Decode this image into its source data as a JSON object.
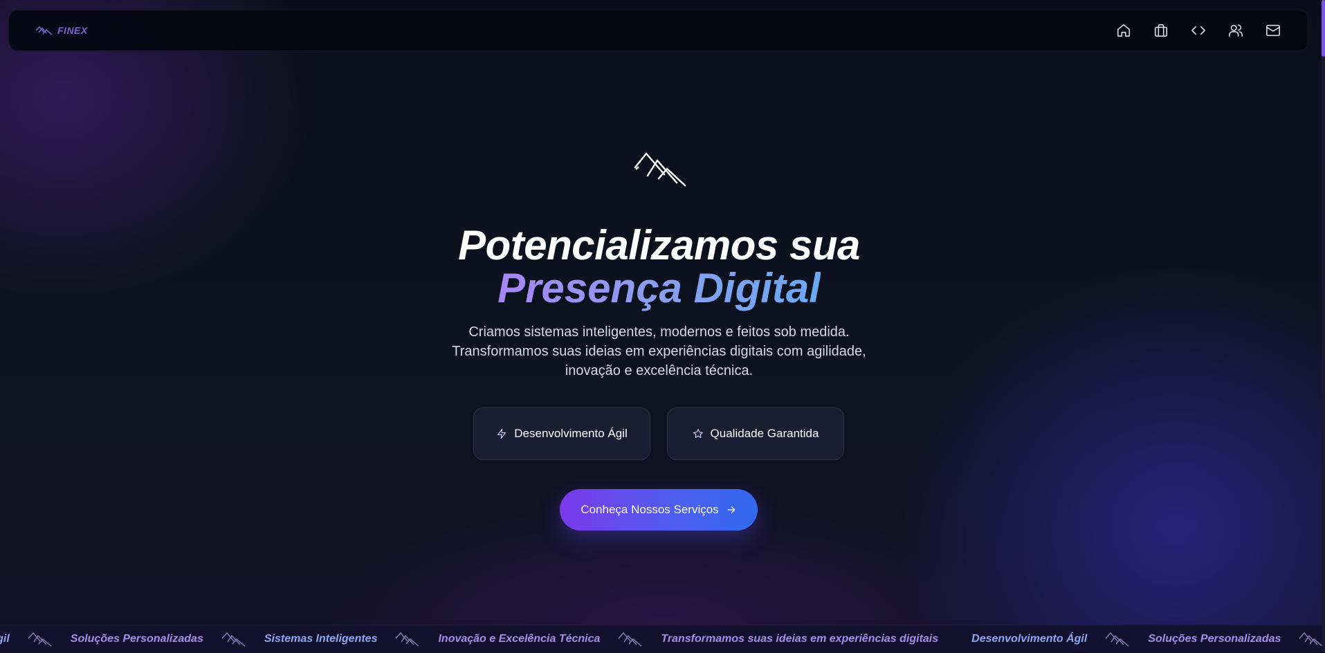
{
  "brand": {
    "name": "FINEX",
    "icon": "finex-mountain-logo"
  },
  "nav": {
    "icons": [
      {
        "name": "home-icon"
      },
      {
        "name": "briefcase-icon"
      },
      {
        "name": "code-icon"
      },
      {
        "name": "users-icon"
      },
      {
        "name": "mail-icon"
      }
    ]
  },
  "hero": {
    "logo": "finex-mountain-logo",
    "title_line1": "Potencializamos sua",
    "title_line2": "Presença Digital",
    "subtitle_lines": [
      "Criamos sistemas inteligentes, modernos e feitos sob medida.",
      "Transformamos suas ideias em experiências digitais com agilidade,",
      "inovação e excelência técnica."
    ],
    "features": [
      {
        "label": "Desenvolvimento Ágil",
        "icon": "lightning-icon"
      },
      {
        "label": "Qualidade Garantida",
        "icon": "star-icon"
      }
    ],
    "cta_label": "Conheça Nossos Serviços",
    "cta_icon": "arrow-right-icon"
  },
  "ticker": {
    "items": [
      "to Ágil",
      "Soluções Personalizadas",
      "Sistemas Inteligentes",
      "Inovação e Excelência Técnica",
      "Transformamos suas ideias em experiências digitais",
      "Desenvolvimento Ágil",
      "Soluções Personalizadas"
    ]
  },
  "colors": {
    "accent_purple": "#7a39ea",
    "accent_blue": "#3169ee",
    "title_gradient_start": "#a786f4",
    "title_gradient_end": "#6aa9f2"
  }
}
